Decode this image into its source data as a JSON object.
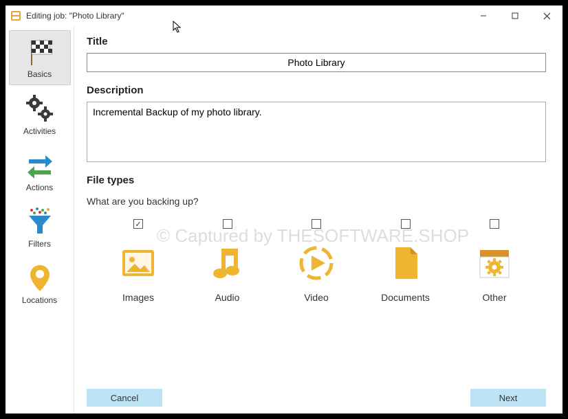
{
  "window": {
    "title": "Editing job: \"Photo Library\""
  },
  "sidebar": {
    "items": [
      {
        "key": "basics",
        "label": "Basics",
        "active": true
      },
      {
        "key": "activities",
        "label": "Activities",
        "active": false
      },
      {
        "key": "actions",
        "label": "Actions",
        "active": false
      },
      {
        "key": "filters",
        "label": "Filters",
        "active": false
      },
      {
        "key": "locations",
        "label": "Locations",
        "active": false
      }
    ]
  },
  "form": {
    "title_label": "Title",
    "title_value": "Photo Library",
    "description_label": "Description",
    "description_value": "Incremental Backup of my photo library.",
    "filetypes_label": "File types",
    "filetypes_question": "What are you backing up?",
    "filetypes": [
      {
        "key": "images",
        "label": "Images",
        "checked": true
      },
      {
        "key": "audio",
        "label": "Audio",
        "checked": false
      },
      {
        "key": "video",
        "label": "Video",
        "checked": false
      },
      {
        "key": "documents",
        "label": "Documents",
        "checked": false
      },
      {
        "key": "other",
        "label": "Other",
        "checked": false
      }
    ]
  },
  "buttons": {
    "cancel": "Cancel",
    "next": "Next"
  },
  "watermark": "© Captured by THESOFTWARE.SHOP"
}
